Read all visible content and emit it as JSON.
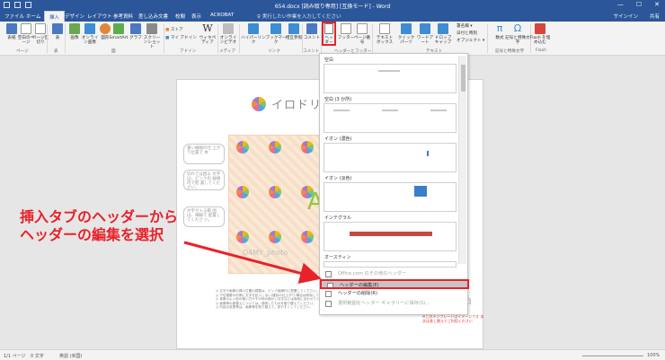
{
  "titlebar": {
    "title": "654.docx [読み取り専用] [互換モード] - Word"
  },
  "tabs": [
    {
      "label": "ファイル",
      "active": false
    },
    {
      "label": "ホーム",
      "active": false
    },
    {
      "label": "挿入",
      "active": true
    },
    {
      "label": "デザイン",
      "active": false
    },
    {
      "label": "レイアウト",
      "active": false
    },
    {
      "label": "参考資料",
      "active": false
    },
    {
      "label": "差し込み文書",
      "active": false
    },
    {
      "label": "校閲",
      "active": false
    },
    {
      "label": "表示",
      "active": false
    },
    {
      "label": "ACROBAT",
      "active": false
    }
  ],
  "tell_me": "♀ 実行したい作業を入力してください",
  "user": "サインイン",
  "share": "共有",
  "ribbon": {
    "buttons": [
      {
        "label": "表紙",
        "icon": "cover-page-icon",
        "color": "#4a78c2"
      },
      {
        "label": "空白のページ",
        "icon": "blank-page-icon",
        "color": "#ffffff"
      },
      {
        "label": "ページ区切り",
        "icon": "page-break-icon",
        "color": "#ffffff"
      },
      {
        "label": "表",
        "icon": "table-icon",
        "color": "#4a78c2"
      },
      {
        "label": "画像",
        "icon": "picture-icon",
        "color": "#6aa84f"
      },
      {
        "label": "オンライン画像",
        "icon": "online-picture-icon",
        "color": "#3c8dd4"
      },
      {
        "label": "図形",
        "icon": "shapes-icon",
        "color": "#e0883a"
      },
      {
        "label": "SmartArt",
        "icon": "smartart-icon",
        "color": "#5cae4c"
      },
      {
        "label": "グラフ",
        "icon": "chart-icon",
        "color": "#4a78c2"
      },
      {
        "label": "スクリーンショット",
        "icon": "screenshot-icon",
        "color": "#8a8a8a"
      },
      {
        "label": "ストア",
        "icon": "store-icon",
        "color": "#e0883a"
      },
      {
        "label": "マイ アドイン",
        "icon": "my-addins-icon",
        "color": "#3c8dd4"
      },
      {
        "label": "ウィキペディア",
        "icon": "wikipedia-icon",
        "color": "#333333"
      },
      {
        "label": "オンラインビデオ",
        "icon": "online-video-icon",
        "color": "#bdbdbd"
      },
      {
        "label": "ハイパーリンク",
        "icon": "hyperlink-icon",
        "color": "#3c8dd4"
      },
      {
        "label": "ブックマーク",
        "icon": "bookmark-icon",
        "color": "#3c8dd4"
      },
      {
        "label": "相互参照",
        "icon": "cross-reference-icon",
        "color": "#3c8dd4"
      },
      {
        "label": "コメント",
        "icon": "comment-icon",
        "color": "#4a78c2"
      },
      {
        "label": "ヘッダー",
        "icon": "header-icon",
        "color": "#ffffff"
      },
      {
        "label": "フッター",
        "icon": "footer-icon",
        "color": "#ffffff"
      },
      {
        "label": "ページ番号",
        "icon": "page-number-icon",
        "color": "#ffffff"
      },
      {
        "label": "テキストボックス",
        "icon": "textbox-icon",
        "color": "#ffffff"
      },
      {
        "label": "クイックパーツ",
        "icon": "quick-parts-icon",
        "color": "#3c8dd4"
      },
      {
        "label": "ワードアート",
        "icon": "wordart-icon",
        "color": "#3c8dd4"
      },
      {
        "label": "ドロップキャップ",
        "icon": "dropcap-icon",
        "color": "#3c8dd4"
      },
      {
        "label": "数式",
        "icon": "equation-icon",
        "color": "#3c8dd4"
      },
      {
        "label": "記号と特殊文字",
        "icon": "symbol-icon",
        "color": "#3c8dd4"
      },
      {
        "label": "Flash を埋め込む",
        "icon": "flash-icon",
        "color": "#d9453b"
      }
    ],
    "side_items": [
      "署名欄 ▾",
      "日付と時刻",
      "オブジェクト ▾"
    ],
    "groups": [
      "ページ",
      "表",
      "図",
      "アドイン",
      "メディア",
      "リンク",
      "コメント",
      "ヘッダーとフッター",
      "テキスト",
      "記号と特殊文字",
      "Flash"
    ]
  },
  "gallery": {
    "sections": [
      {
        "label": "空白"
      },
      {
        "label": "空白 (3 か所)"
      },
      {
        "label": "イオン (濃色)"
      },
      {
        "label": "イオン (淡色)"
      },
      {
        "label": "インテグラル"
      },
      {
        "label": "オースティン"
      }
    ],
    "menu": [
      {
        "label": "Office.com のその他のヘッダー",
        "state": "dim"
      },
      {
        "label": "ヘッダーの編集(E)",
        "state": "highlighted"
      },
      {
        "label": "ヘッダーの削除(R)",
        "state": "normal"
      },
      {
        "label": "選択範囲をヘッダー ギャラリーに保存(S)...",
        "state": "dim"
      }
    ]
  },
  "document": {
    "logo_text": "イロドリ",
    "callouts": [
      "書い線線の仕 上がり位置で 本",
      "切れては困る 文字は、ピンクの 破線内で配 置してください。",
      "文字が入る範 囲は、細線で 配置してくださ い。"
    ],
    "big_letter": "A",
    "watermark": "D4MY_photo",
    "bullets": [
      "◎ 文字や画像の挿入位置の調整は、ピンク破線内に配置してください。",
      "◎ 下位階層の内側に文字を記入しない(雑誌の仕上がり)場合は削除してください。",
      "◎ 背景のよい色の使い方やその他の細かい文字などは用紙に合わせてください。",
      "◎ 画像等の差替えについては、使用したものを取り替えてください。",
      "◎ 内容の変更等は、画像等を貼り替えて、見やすくしてください。"
    ],
    "template_text": "templia",
    "red_note": "※このテンプレートはイメージです 本文は差し替えてご利用ください"
  },
  "annotation": {
    "line1": "挿入タブのヘッダーから",
    "line2": "ヘッダーの編集を選択"
  },
  "statusbar": {
    "page": "1/1 ページ",
    "words": "0 文字",
    "lang": "英語 (米国)",
    "zoom": "100%"
  },
  "colors": {
    "titlebar": "#2b579a",
    "accent_red": "#e8222a",
    "highlight": "#c5c5c5"
  }
}
